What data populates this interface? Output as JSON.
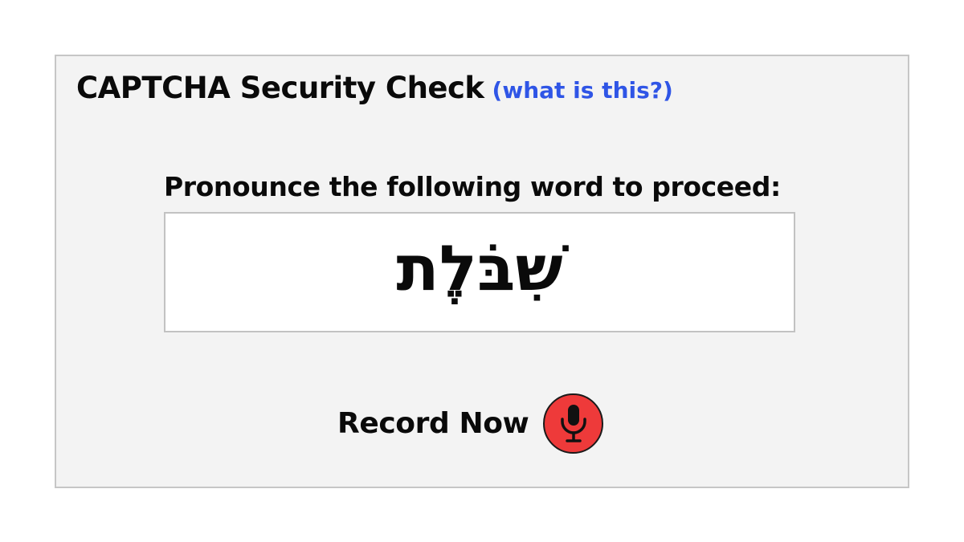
{
  "captcha": {
    "title": "CAPTCHA Security Check",
    "help_link": "(what is this?)",
    "instruction": "Pronounce the following word to proceed:",
    "word": "שִׁבֹּלֶת",
    "record_label": "Record Now",
    "record_icon": "microphone-icon"
  },
  "colors": {
    "panel_background": "#f3f3f3",
    "link": "#2f55e6",
    "record_button": "#ee3a3a"
  }
}
